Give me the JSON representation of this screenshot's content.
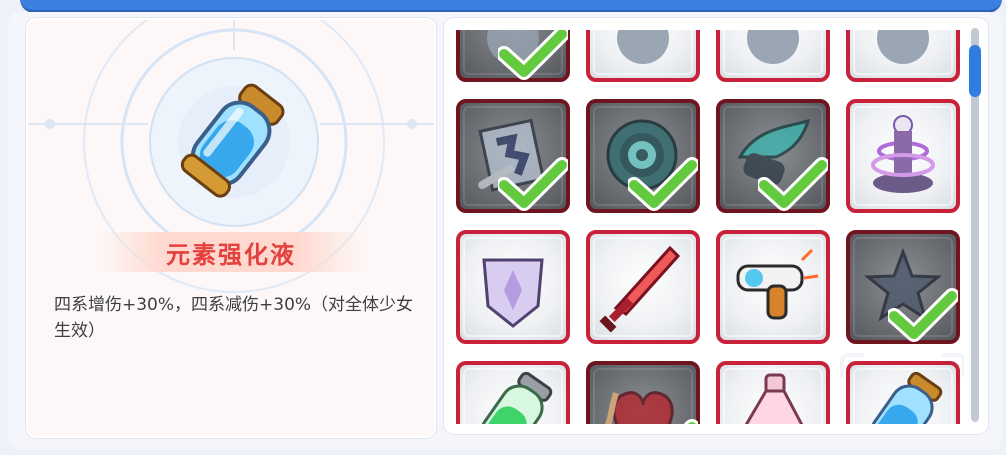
{
  "detail": {
    "item_name": "元素强化液",
    "description": "四系增伤+30%，四系减伤+30%（对全体少女生效）",
    "item_icon": "blue-potion-capsule-icon"
  },
  "colors": {
    "accent_blue": "#2f7de0",
    "tile_border": "#c8223a",
    "owned_border": "#6e1520",
    "name_text": "#e4403d",
    "check_green": "#63c93e"
  },
  "grid": {
    "items": [
      {
        "icon": "partial-item-icon",
        "owned": true
      },
      {
        "icon": "partial-item-icon",
        "owned": false
      },
      {
        "icon": "partial-item-icon",
        "owned": false
      },
      {
        "icon": "partial-item-icon",
        "owned": false
      },
      {
        "icon": "puzzle-map-icon",
        "owned": true
      },
      {
        "icon": "teal-gear-wheel-icon",
        "owned": true
      },
      {
        "icon": "winged-gauntlet-icon",
        "owned": true
      },
      {
        "icon": "purple-crystal-tower-icon",
        "owned": false
      },
      {
        "icon": "crystal-shield-icon",
        "owned": false
      },
      {
        "icon": "red-sword-icon",
        "owned": false
      },
      {
        "icon": "laser-pistol-icon",
        "owned": false
      },
      {
        "icon": "dark-star-icon",
        "owned": true
      },
      {
        "icon": "green-potion-capsule-icon",
        "owned": false
      },
      {
        "icon": "red-heart-icon",
        "owned": true
      },
      {
        "icon": "pink-potion-bottle-icon",
        "owned": false
      },
      {
        "icon": "blue-potion-capsule-icon",
        "owned": false,
        "selected": true
      }
    ]
  },
  "scroll": {
    "position": 0.05
  }
}
